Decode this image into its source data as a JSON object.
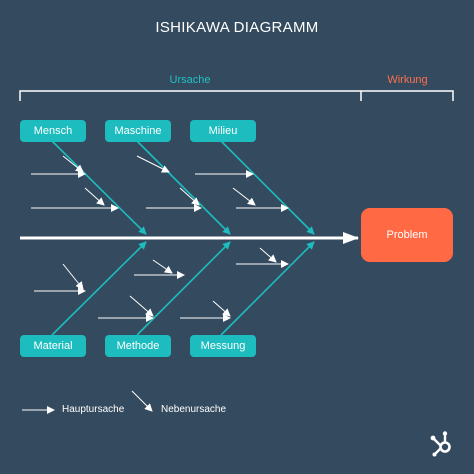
{
  "title": "ISHIKAWA DIAGRAMM",
  "ursache_label": "Ursache",
  "wirkung_label": "Wirkung",
  "categories_top": [
    "Mensch",
    "Maschine",
    "Milieu"
  ],
  "categories_bottom": [
    "Material",
    "Methode",
    "Messung"
  ],
  "problem_label": "Problem",
  "legend": {
    "main_cause": "Hauptursache",
    "sub_cause": "Nebenursache"
  },
  "colors": {
    "background": "#344a5e",
    "teal": "#1dbcbe",
    "orange": "#ff6a45",
    "white": "#ffffff"
  },
  "logo_icon": "hubspot-logo-icon"
}
